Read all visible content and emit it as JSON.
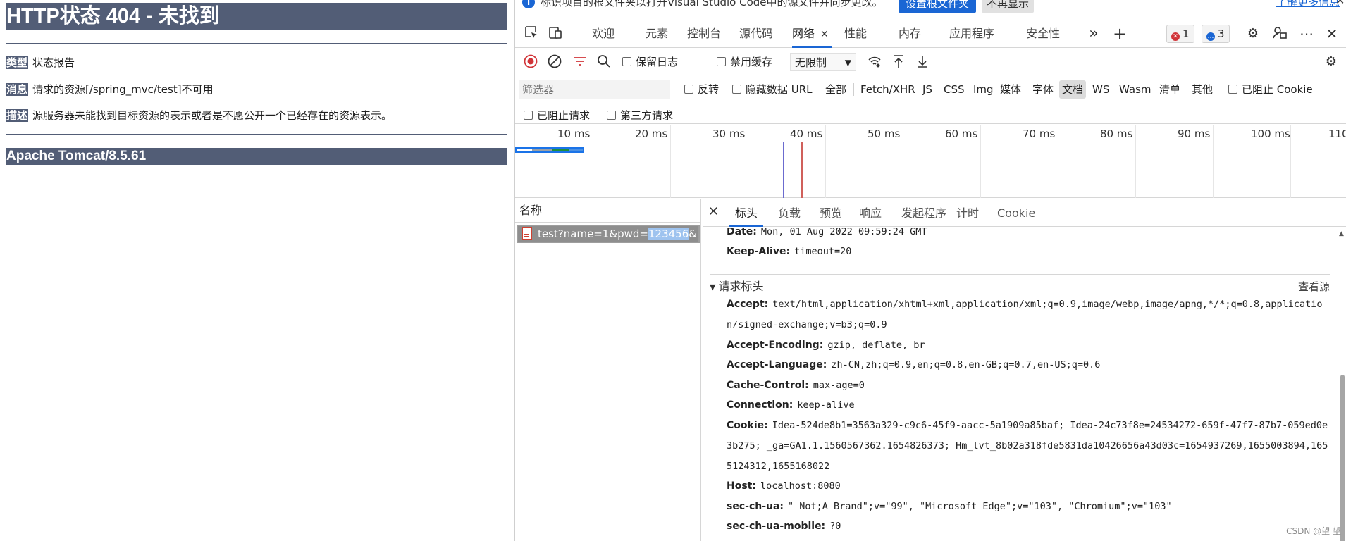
{
  "tomcat": {
    "title": "HTTP状态 404 - 未找到",
    "type_label": "类型",
    "type_value": "状态报告",
    "message_label": "消息",
    "message_value": "请求的资源[/spring_mvc/test]不可用",
    "desc_label": "描述",
    "desc_value": "源服务器未能找到目标资源的表示或者是不愿公开一个已经存在的资源表示。",
    "footer": "Apache Tomcat/8.5.61"
  },
  "infobar": {
    "message": "标识项目的根文件夹以打开Visual Studio Code中的源文件并同步更改。",
    "set_root_btn": "设置根文件夹",
    "dont_show_btn": "不再显示",
    "learn_more": "了解更多信息"
  },
  "tabs": [
    {
      "label": "欢迎"
    },
    {
      "label": "元素"
    },
    {
      "label": "控制台"
    },
    {
      "label": "源代码"
    },
    {
      "label": "网络"
    },
    {
      "label": "性能"
    },
    {
      "label": "内存"
    },
    {
      "label": "应用程序"
    },
    {
      "label": "安全性"
    }
  ],
  "badges": {
    "errors": "1",
    "messages": "3"
  },
  "toolbar": {
    "preserve_log": "保留日志",
    "disable_cache": "禁用缓存",
    "throttling": "无限制"
  },
  "filter": {
    "placeholder": "筛选器",
    "invert": "反转",
    "hide_data_urls": "隐藏数据 URL",
    "types": [
      "全部",
      "Fetch/XHR",
      "JS",
      "CSS",
      "Img",
      "媒体",
      "字体",
      "文档",
      "WS",
      "Wasm",
      "清单",
      "其他"
    ],
    "blocked_cookies": "已阻止 Cookie",
    "blocked_requests": "已阻止请求",
    "third_party": "第三方请求"
  },
  "timeline": {
    "labels": [
      "10 ms",
      "20 ms",
      "30 ms",
      "40 ms",
      "50 ms",
      "60 ms",
      "70 ms",
      "80 ms",
      "90 ms",
      "100 ms",
      "110"
    ]
  },
  "requests": {
    "header": "名称",
    "row_prefix": "test?name=1&pwd=",
    "row_highlight": "123456",
    "row_suffix": "&..."
  },
  "detail_tabs": [
    "标头",
    "负载",
    "预览",
    "响应",
    "发起程序",
    "计时",
    "Cookie"
  ],
  "response_headers": [
    {
      "name": "Date:",
      "value": "Mon, 01 Aug 2022 09:59:24 GMT"
    },
    {
      "name": "Keep-Alive:",
      "value": "timeout=20"
    }
  ],
  "request_section": {
    "title": "请求标头",
    "view_source": "查看源"
  },
  "request_headers": [
    {
      "name": "Accept:",
      "value": "text/html,application/xhtml+xml,application/xml;q=0.9,image/webp,image/apng,*/*;q=0.8,application/signed-exchange;v=b3;q=0.9"
    },
    {
      "name": "Accept-Encoding:",
      "value": "gzip, deflate, br"
    },
    {
      "name": "Accept-Language:",
      "value": "zh-CN,zh;q=0.9,en;q=0.8,en-GB;q=0.7,en-US;q=0.6"
    },
    {
      "name": "Cache-Control:",
      "value": "max-age=0"
    },
    {
      "name": "Connection:",
      "value": "keep-alive"
    },
    {
      "name": "Cookie:",
      "value": "Idea-524de8b1=3563a329-c9c6-45f9-aacc-5a1909a85baf; Idea-24c73f8e=24534272-659f-47f7-87b7-059ed0e3b275; _ga=GA1.1.1560567362.1654826373; Hm_lvt_8b02a318fde5831da10426656a43d03c=1654937269,1655003894,1655124312,1655168022"
    },
    {
      "name": "Host:",
      "value": "localhost:8080"
    },
    {
      "name": "sec-ch-ua:",
      "value": "\" Not;A Brand\";v=\"99\", \"Microsoft Edge\";v=\"103\", \"Chromium\";v=\"103\""
    },
    {
      "name": "sec-ch-ua-mobile:",
      "value": "?0"
    }
  ],
  "watermark": "CSDN @望 望"
}
